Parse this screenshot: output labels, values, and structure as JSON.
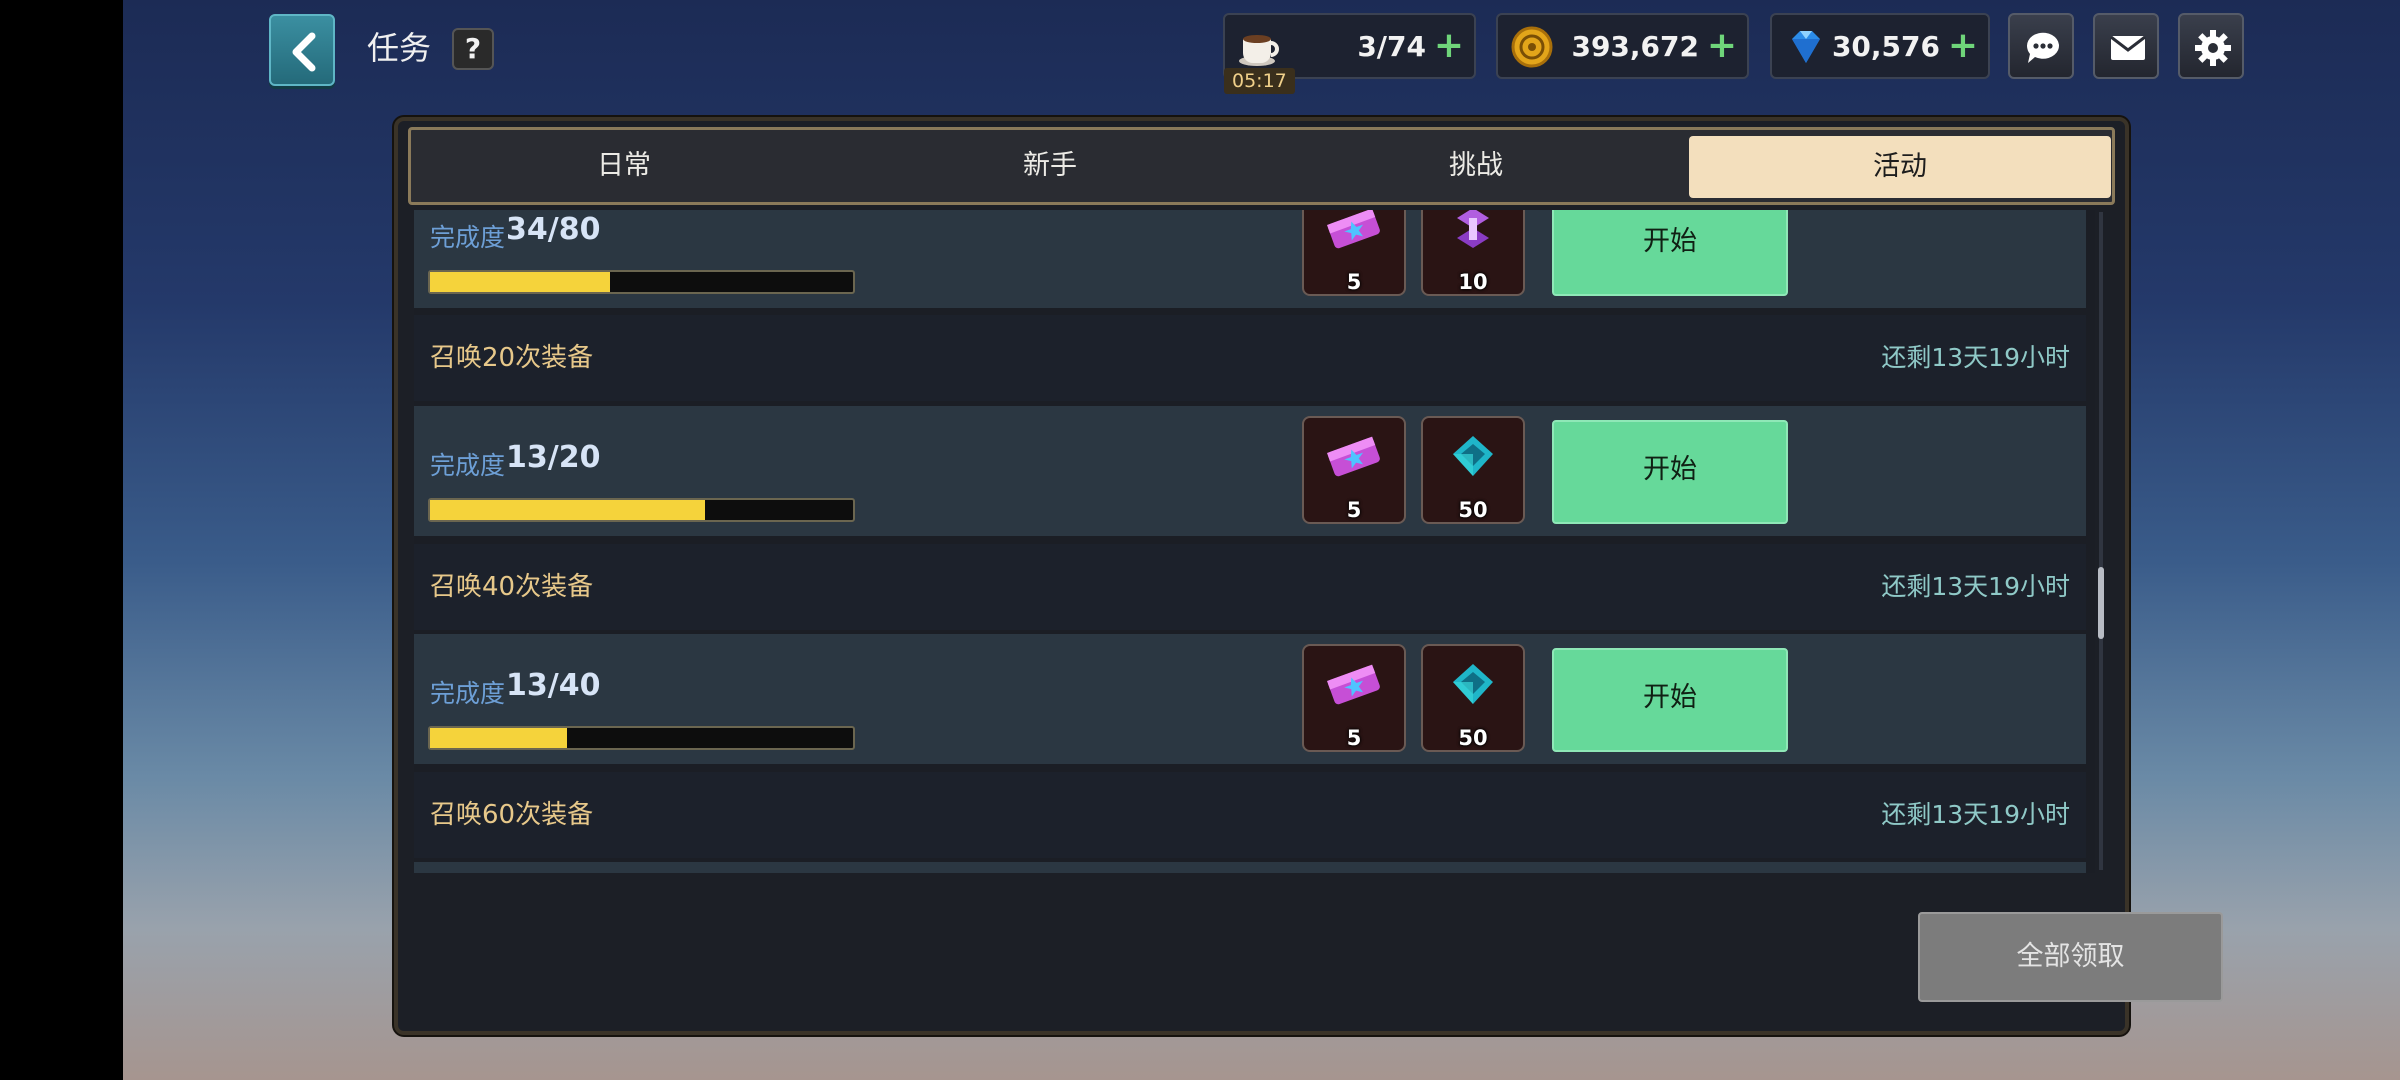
{
  "header": {
    "title": "任务",
    "help_label": "?",
    "stamina": {
      "value": "3/74",
      "timer": "05:17",
      "icon": "coffee-cup-icon"
    },
    "gold": {
      "value": "393,672",
      "icon": "gold-coin-icon"
    },
    "gems": {
      "value": "30,576",
      "icon": "blue-diamond-icon"
    },
    "plus": "+"
  },
  "tabs": [
    {
      "label": "日常",
      "active": false
    },
    {
      "label": "新手",
      "active": false
    },
    {
      "label": "挑战",
      "active": false
    },
    {
      "label": "活动",
      "active": true
    }
  ],
  "quests": [
    {
      "name": "",
      "time_left": "",
      "progress_label": "完成度",
      "progress": "34/80",
      "fill": 0.425,
      "rewards": [
        {
          "icon": "summon-ticket-icon",
          "count": "5"
        },
        {
          "icon": "purple-key-icon",
          "count": "10"
        }
      ],
      "button": "开始"
    },
    {
      "name": "召唤20次装备",
      "time_left": "还剩13天19小时",
      "progress_label": "完成度",
      "progress": "13/20",
      "fill": 0.65,
      "rewards": [
        {
          "icon": "summon-ticket-icon",
          "count": "5"
        },
        {
          "icon": "teal-crystal-icon",
          "count": "50"
        }
      ],
      "button": "开始"
    },
    {
      "name": "召唤40次装备",
      "time_left": "还剩13天19小时",
      "progress_label": "完成度",
      "progress": "13/40",
      "fill": 0.325,
      "rewards": [
        {
          "icon": "summon-ticket-icon",
          "count": "5"
        },
        {
          "icon": "teal-crystal-icon",
          "count": "50"
        }
      ],
      "button": "开始"
    },
    {
      "name": "召唤60次装备",
      "time_left": "还剩13天19小时"
    }
  ],
  "footer": {
    "claim_all": "全部领取"
  },
  "colors": {
    "accent_green": "#66d99a",
    "progress_yellow": "#f5d33b",
    "tab_active": "#f3dfbd"
  }
}
